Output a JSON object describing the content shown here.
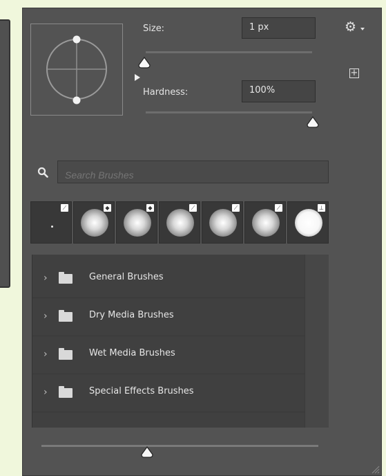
{
  "brush_panel": {
    "size_label": "Size:",
    "size_value": "1 px",
    "size_fraction": 0.0,
    "hardness_label": "Hardness:",
    "hardness_value": "100%",
    "hardness_fraction": 1.0,
    "settings_icon": "gear-icon",
    "new_preset_icon": "plus-square-icon",
    "search_placeholder": "Search Brushes",
    "search_value": "",
    "brush_presets": [
      {
        "name": "brush-1",
        "badge": "brush-icon"
      },
      {
        "name": "brush-2",
        "badge": "eraser-icon"
      },
      {
        "name": "brush-3",
        "badge": "eraser-icon"
      },
      {
        "name": "brush-4",
        "badge": "brush-icon"
      },
      {
        "name": "brush-5",
        "badge": "brush-icon"
      },
      {
        "name": "brush-6",
        "badge": "brush-icon"
      },
      {
        "name": "brush-7",
        "badge": "stamp-icon"
      }
    ],
    "folders": [
      {
        "label": "General Brushes"
      },
      {
        "label": "Dry Media Brushes"
      },
      {
        "label": "Wet Media Brushes"
      },
      {
        "label": "Special Effects Brushes"
      }
    ],
    "preview_size_fraction": 0.4
  }
}
